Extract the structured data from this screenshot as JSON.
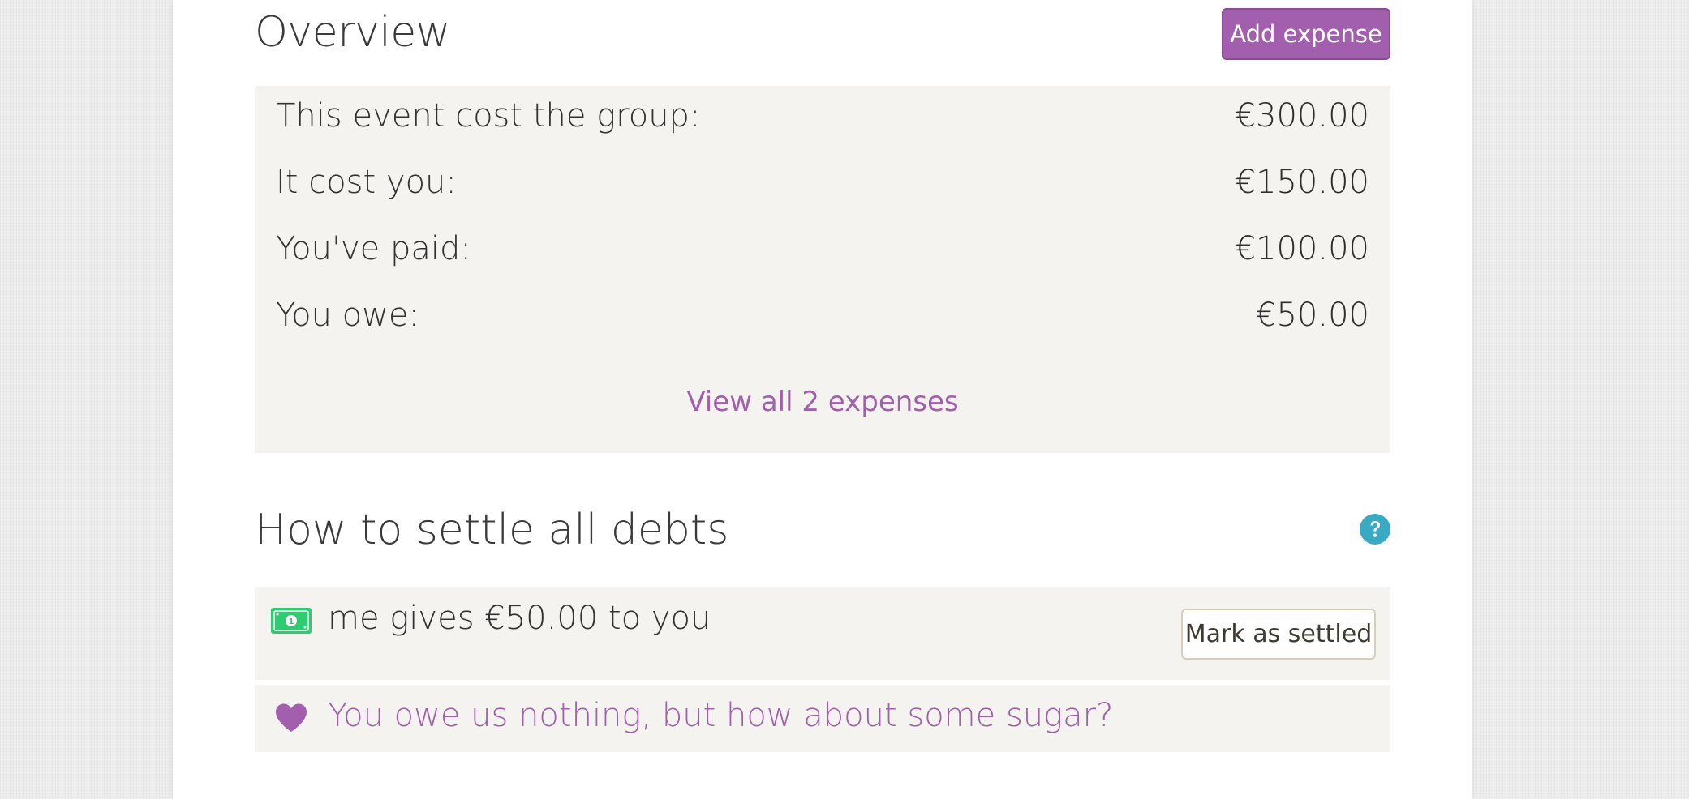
{
  "overview": {
    "title": "Overview",
    "add_expense_label": "Add expense",
    "rows": [
      {
        "label": "This event cost the group:",
        "value": "€300.00"
      },
      {
        "label": "It cost you:",
        "value": "€150.00"
      },
      {
        "label": "You've paid:",
        "value": "€100.00"
      },
      {
        "label": "You owe:",
        "value": "€50.00"
      }
    ],
    "view_all_label": "View all 2 expenses"
  },
  "settle": {
    "title": "How to settle all debts",
    "help_icon": "question-circle-icon",
    "debts": [
      {
        "icon": "money-bill-icon",
        "text": "me gives €50.00 to you",
        "button_label": "Mark as settled"
      }
    ],
    "sugar": {
      "icon": "heart-icon",
      "text": "You owe us nothing, but how about some sugar?"
    }
  },
  "colors": {
    "accent": "#a25fad",
    "panel_bg": "#f4f3f0",
    "help": "#3aaac4",
    "money": "#2ecc71"
  }
}
